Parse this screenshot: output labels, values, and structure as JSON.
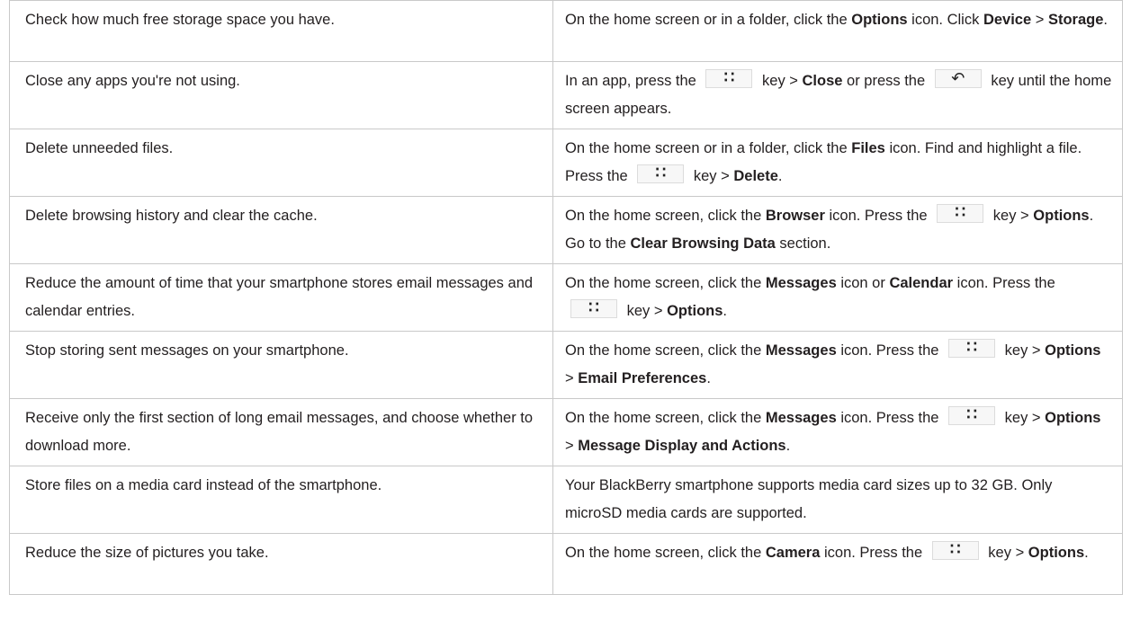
{
  "rows": [
    {
      "tip": "Check how much free storage space you have.",
      "how": [
        {
          "t": "On the home screen or in a folder, click the "
        },
        {
          "t": "Options",
          "b": true
        },
        {
          "t": " icon. Click "
        },
        {
          "t": "Device",
          "b": true
        },
        {
          "t": " > "
        },
        {
          "t": "Storage",
          "b": true
        },
        {
          "t": "."
        }
      ]
    },
    {
      "tip": "Close any apps you're not using.",
      "how": [
        {
          "t": "In an app, press the "
        },
        {
          "k": "blackberry-menu-key-icon"
        },
        {
          "t": " key > "
        },
        {
          "t": "Close",
          "b": true
        },
        {
          "t": " or press the "
        },
        {
          "k": "escape-key-icon"
        },
        {
          "t": " key until the home screen appears."
        }
      ]
    },
    {
      "tip": "Delete unneeded files.",
      "how": [
        {
          "t": "On the home screen or in a folder, click the "
        },
        {
          "t": "Files",
          "b": true
        },
        {
          "t": " icon. Find and highlight a file. Press the "
        },
        {
          "k": "blackberry-menu-key-icon"
        },
        {
          "t": " key > "
        },
        {
          "t": "Delete",
          "b": true
        },
        {
          "t": "."
        }
      ]
    },
    {
      "tip": "Delete browsing history and clear the cache.",
      "how": [
        {
          "t": "On the home screen, click the "
        },
        {
          "t": "Browser",
          "b": true
        },
        {
          "t": " icon. Press the "
        },
        {
          "k": "blackberry-menu-key-icon"
        },
        {
          "t": " key > "
        },
        {
          "t": "Options",
          "b": true
        },
        {
          "t": ". Go to the "
        },
        {
          "t": "Clear Browsing Data",
          "b": true
        },
        {
          "t": " section."
        }
      ]
    },
    {
      "tip": "Reduce the amount of time that your smartphone stores email messages and calendar entries.",
      "how": [
        {
          "t": "On the home screen, click the "
        },
        {
          "t": "Messages",
          "b": true
        },
        {
          "t": " icon or "
        },
        {
          "t": "Calendar",
          "b": true
        },
        {
          "t": " icon. Press the "
        },
        {
          "k": "blackberry-menu-key-icon"
        },
        {
          "t": " key > "
        },
        {
          "t": "Options",
          "b": true
        },
        {
          "t": "."
        }
      ]
    },
    {
      "tip": "Stop storing sent messages on your smartphone.",
      "how": [
        {
          "t": "On the home screen, click the "
        },
        {
          "t": "Messages",
          "b": true
        },
        {
          "t": " icon. Press the "
        },
        {
          "k": "blackberry-menu-key-icon"
        },
        {
          "t": " key > "
        },
        {
          "t": "Options",
          "b": true
        },
        {
          "t": " > "
        },
        {
          "t": "Email Preferences",
          "b": true
        },
        {
          "t": "."
        }
      ]
    },
    {
      "tip": "Receive only the first section of long email messages, and choose whether to download more.",
      "how": [
        {
          "t": "On the home screen, click the "
        },
        {
          "t": "Messages",
          "b": true
        },
        {
          "t": " icon. Press the "
        },
        {
          "k": "blackberry-menu-key-icon"
        },
        {
          "t": " key > "
        },
        {
          "t": "Options",
          "b": true
        },
        {
          "t": " > "
        },
        {
          "t": "Message Display and Actions",
          "b": true
        },
        {
          "t": "."
        }
      ]
    },
    {
      "tip": "Store files on a media card instead of the smartphone.",
      "how": [
        {
          "t": "Your BlackBerry smartphone supports media card sizes up to 32 GB. Only microSD media cards are supported."
        }
      ]
    },
    {
      "tip": "Reduce the size of pictures you take.",
      "how": [
        {
          "t": "On the home screen, click the "
        },
        {
          "t": "Camera",
          "b": true
        },
        {
          "t": " icon. Press the "
        },
        {
          "k": "blackberry-menu-key-icon"
        },
        {
          "t": " key > "
        },
        {
          "t": "Options",
          "b": true
        },
        {
          "t": "."
        }
      ]
    }
  ]
}
